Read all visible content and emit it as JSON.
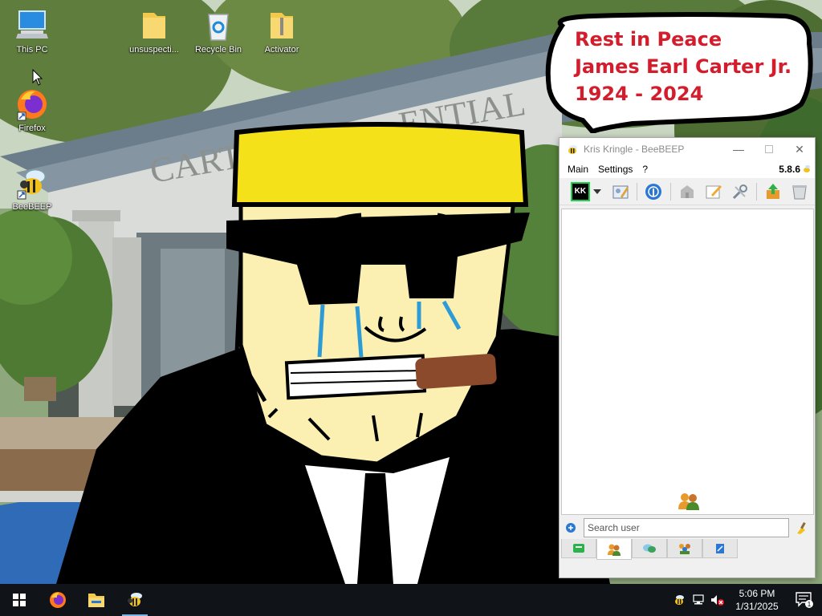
{
  "desktop": {
    "icons": [
      {
        "label": "This PC",
        "icon": "this-pc-icon"
      },
      {
        "label": "unsuspecti...",
        "icon": "folder-icon"
      },
      {
        "label": "Recycle Bin",
        "icon": "recycle-bin-icon"
      },
      {
        "label": "Activator",
        "icon": "zip-folder-icon"
      },
      {
        "label": "Firefox",
        "icon": "firefox-icon"
      },
      {
        "label": "BeeBEEP",
        "icon": "beebeep-icon"
      }
    ],
    "wallpaper": {
      "building_sign": "CARTE",
      "building_sign_2": "ENTIAL",
      "bubble_lines": [
        "Rest in Peace",
        "James Earl Carter Jr.",
        "1924 - 2024"
      ]
    }
  },
  "window": {
    "title": "Kris Kringle - BeeBEEP",
    "menu": [
      "Main",
      "Settings",
      "?"
    ],
    "version": "5.8.6",
    "toolbar": [
      {
        "icon": "kk-avatar-icon",
        "text": "KK"
      },
      {
        "icon": "dropdown-arrow-icon"
      },
      {
        "icon": "edit-profile-icon"
      },
      {
        "icon": "network-icon"
      },
      {
        "icon": "group-icon"
      },
      {
        "icon": "note-edit-icon"
      },
      {
        "icon": "tools-icon"
      },
      {
        "icon": "share-icon"
      },
      {
        "icon": "trash-icon"
      }
    ],
    "search": {
      "placeholder": "Search user"
    },
    "tabs": [
      {
        "icon": "chat-tab-icon"
      },
      {
        "icon": "users-tab-icon",
        "active": true
      },
      {
        "icon": "messages-tab-icon"
      },
      {
        "icon": "groups-tab-icon"
      },
      {
        "icon": "files-tab-icon"
      }
    ]
  },
  "taskbar": {
    "apps": [
      "start-icon",
      "firefox-icon",
      "file-explorer-icon",
      "beebeep-icon"
    ],
    "tray": [
      "beebeep-tray-icon",
      "network-tray-icon",
      "volume-muted-icon"
    ],
    "time": "5:06 PM",
    "date": "1/31/2025",
    "notification_count": "1"
  },
  "colors": {
    "bubble_text": "#d31c2c",
    "taskbar": "#101418",
    "cap_yellow": "#f5e11a"
  }
}
